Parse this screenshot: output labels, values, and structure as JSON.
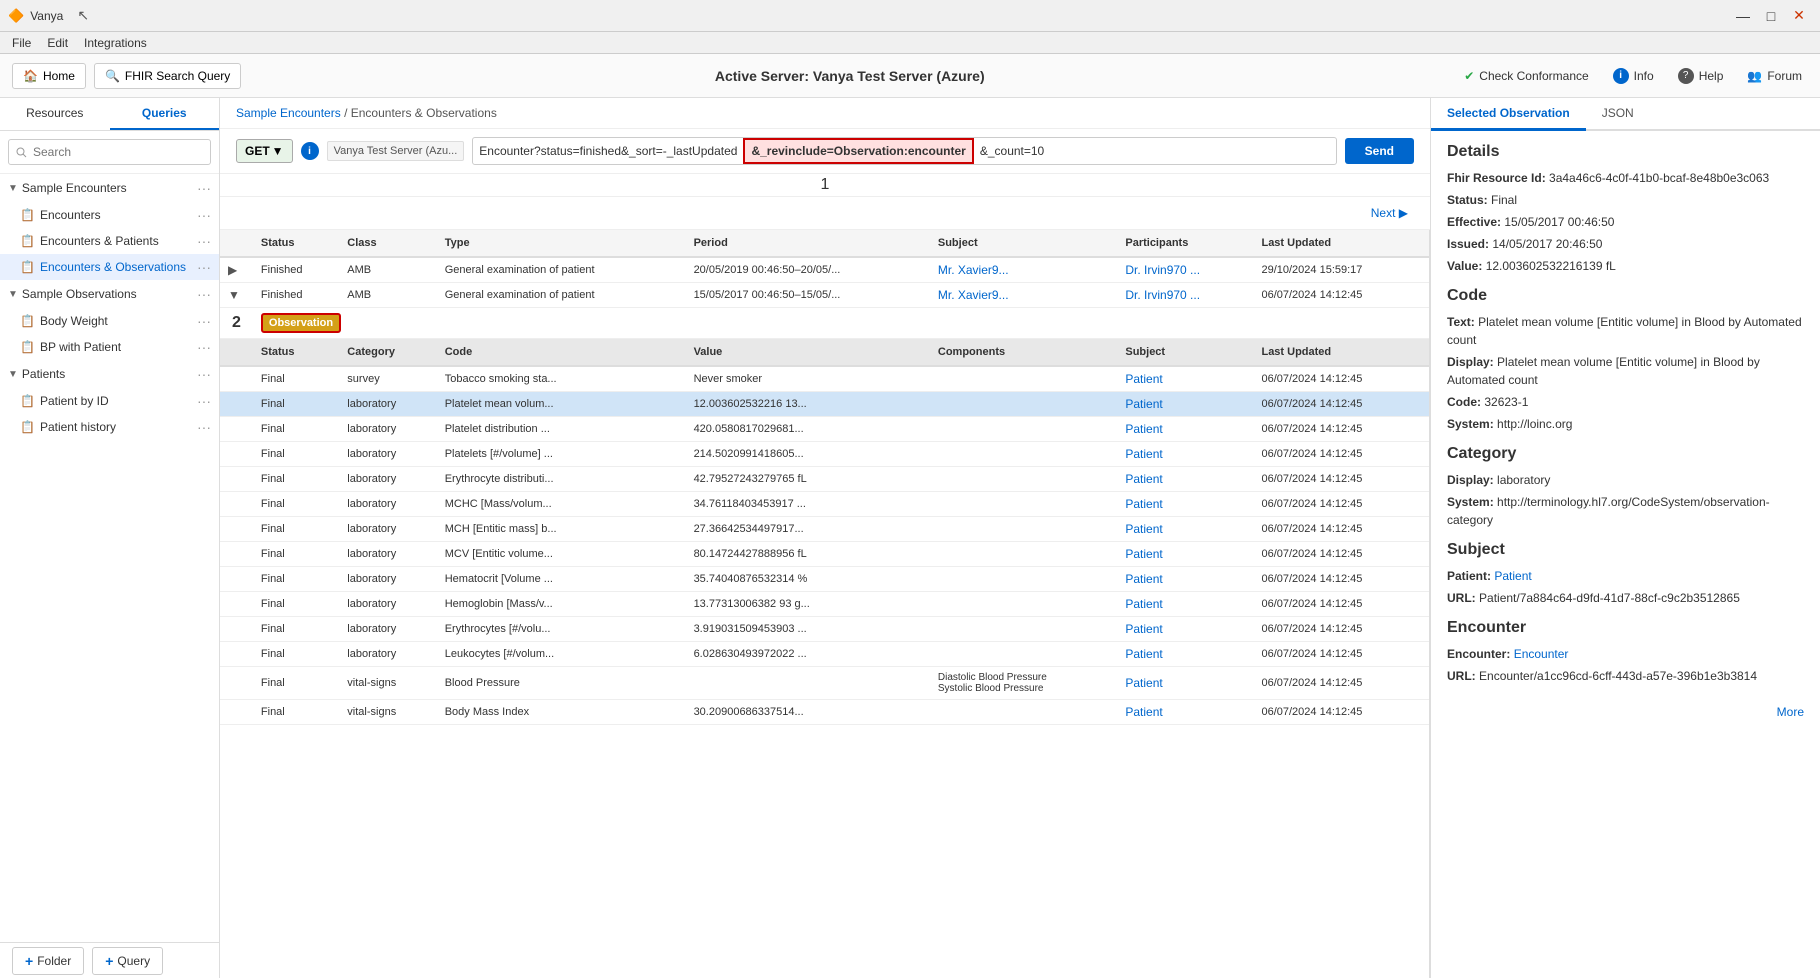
{
  "app": {
    "title": "Vanya",
    "logo_color": "#cc3300"
  },
  "titlebar": {
    "title": "Vanya",
    "controls": [
      "—",
      "□",
      "✕"
    ]
  },
  "menubar": {
    "items": [
      "File",
      "Edit",
      "Integrations"
    ]
  },
  "toolbar": {
    "home_label": "Home",
    "fhir_label": "FHIR Search Query",
    "active_server": "Active Server: Vanya Test Server (Azure)",
    "check_conformance": "Check Conformance",
    "info": "Info",
    "help": "Help",
    "forum": "Forum"
  },
  "sidebar": {
    "tabs": [
      "Resources",
      "Queries"
    ],
    "active_tab": "Queries",
    "search_placeholder": "Search",
    "groups": [
      {
        "id": "sample-encounters",
        "label": "Sample Encounters",
        "expanded": true,
        "items": [
          {
            "label": "Encounters",
            "active": false
          },
          {
            "label": "Encounters & Patients",
            "active": false
          },
          {
            "label": "Encounters & Observations",
            "active": true
          }
        ]
      },
      {
        "id": "sample-observations",
        "label": "Sample Observations",
        "expanded": true,
        "items": [
          {
            "label": "Body Weight",
            "active": false
          },
          {
            "label": "BP with Patient",
            "active": false
          }
        ]
      },
      {
        "id": "patients",
        "label": "Patients",
        "expanded": true,
        "items": [
          {
            "label": "Patient by ID",
            "active": false
          },
          {
            "label": "Patient history",
            "active": false
          }
        ]
      }
    ]
  },
  "breadcrumb": {
    "parent": "Sample Encounters",
    "current": "Encounters & Observations"
  },
  "query_bar": {
    "method": "GET",
    "server": "Vanya Test Server (Azu...",
    "query_part1": "Encounter?status=finished&_sort=-_lastUpdated",
    "query_highlight": "&_revinclude=Observation:encounter",
    "query_part2": "&_count=10",
    "send_label": "Send",
    "annotation": "1"
  },
  "nav": {
    "next_label": "Next"
  },
  "table": {
    "columns": [
      "",
      "Status",
      "Class",
      "Type",
      "Period",
      "Subject",
      "Participants",
      "Last Updated"
    ],
    "rows": [
      {
        "expand": "▶",
        "status": "Finished",
        "class": "AMB",
        "type": "General examination of patient",
        "period": "20/05/2019 00:46:50–20/05/...",
        "subject": "Mr. Xavier9...",
        "participants": "Dr. Irvin970 ...",
        "last_updated": "29/10/2024 15:59:17",
        "selected": false
      },
      {
        "expand": "▼",
        "status": "Finished",
        "class": "AMB",
        "type": "General examination of patient",
        "period": "15/05/2017 00:46:50–15/05/...",
        "subject": "Mr. Xavier9...",
        "participants": "Dr. Irvin970 ...",
        "last_updated": "06/07/2024 14:12:45",
        "selected": false
      }
    ],
    "observation_badge": "Observation",
    "annotation_2": "2",
    "obs_columns": [
      "",
      "Status",
      "Category",
      "Code",
      "Value",
      "Components",
      "Subject",
      "Last Updated"
    ],
    "obs_rows": [
      {
        "status": "Final",
        "category": "survey",
        "code": "Tobacco smoking sta...",
        "value": "Never smoker",
        "components": "",
        "subject": "Patient",
        "last_updated": "06/07/2024 14:12:45",
        "selected": false
      },
      {
        "status": "Final",
        "category": "laboratory",
        "code": "Platelet mean volum...",
        "value": "12.003602532216 13...",
        "components": "",
        "subject": "Patient",
        "last_updated": "06/07/2024 14:12:45",
        "selected": true
      },
      {
        "status": "Final",
        "category": "laboratory",
        "code": "Platelet distribution ...",
        "value": "420.0580817029681...",
        "components": "",
        "subject": "Patient",
        "last_updated": "06/07/2024 14:12:45",
        "selected": false
      },
      {
        "status": "Final",
        "category": "laboratory",
        "code": "Platelets [#/volume] ...",
        "value": "214.5020991418605...",
        "components": "",
        "subject": "Patient",
        "last_updated": "06/07/2024 14:12:45",
        "selected": false
      },
      {
        "status": "Final",
        "category": "laboratory",
        "code": "Erythrocyte distributi...",
        "value": "42.79527243279765 fL",
        "components": "",
        "subject": "Patient",
        "last_updated": "06/07/2024 14:12:45",
        "selected": false
      },
      {
        "status": "Final",
        "category": "laboratory",
        "code": "MCHC [Mass/volum...",
        "value": "34.76118403453917 ...",
        "components": "",
        "subject": "Patient",
        "last_updated": "06/07/2024 14:12:45",
        "selected": false
      },
      {
        "status": "Final",
        "category": "laboratory",
        "code": "MCH [Entitic mass] b...",
        "value": "27.36642534497917...",
        "components": "",
        "subject": "Patient",
        "last_updated": "06/07/2024 14:12:45",
        "selected": false
      },
      {
        "status": "Final",
        "category": "laboratory",
        "code": "MCV [Entitic volume...",
        "value": "80.14724427888956 fL",
        "components": "",
        "subject": "Patient",
        "last_updated": "06/07/2024 14:12:45",
        "selected": false
      },
      {
        "status": "Final",
        "category": "laboratory",
        "code": "Hematocrit [Volume ...",
        "value": "35.74040876532314 %",
        "components": "",
        "subject": "Patient",
        "last_updated": "06/07/2024 14:12:45",
        "selected": false
      },
      {
        "status": "Final",
        "category": "laboratory",
        "code": "Hemoglobin [Mass/v...",
        "value": "13.77313006382 93 g...",
        "components": "",
        "subject": "Patient",
        "last_updated": "06/07/2024 14:12:45",
        "selected": false
      },
      {
        "status": "Final",
        "category": "laboratory",
        "code": "Erythrocytes [#/volu...",
        "value": "3.919031509453903 ...",
        "components": "",
        "subject": "Patient",
        "last_updated": "06/07/2024 14:12:45",
        "selected": false
      },
      {
        "status": "Final",
        "category": "laboratory",
        "code": "Leukocytes [#/volum...",
        "value": "6.028630493972022 ...",
        "components": "",
        "subject": "Patient",
        "last_updated": "06/07/2024 14:12:45",
        "selected": false
      },
      {
        "status": "Final",
        "category": "vital-signs",
        "code": "Blood Pressure",
        "value": "",
        "components": "Diastolic Blood Pressure Systolic Blood Pressure",
        "subject": "Patient",
        "last_updated": "06/07/2024 14:12:45",
        "selected": false
      },
      {
        "status": "Final",
        "category": "vital-signs",
        "code": "Body Mass Index",
        "value": "30.20900686337514...",
        "components": "",
        "subject": "Patient",
        "last_updated": "06/07/2024 14:12:45",
        "selected": false
      }
    ]
  },
  "right_panel": {
    "tabs": [
      "Selected Observation",
      "JSON"
    ],
    "active_tab": "Selected Observation",
    "details": {
      "section_details": "Details",
      "fhir_resource_id_label": "Fhir Resource Id:",
      "fhir_resource_id": "3a4a46c6-4c0f-41b0-bcaf-8e48b0e3c063",
      "status_label": "Status:",
      "status": "Final",
      "effective_label": "Effective:",
      "effective": "15/05/2017 00:46:50",
      "issued_label": "Issued:",
      "issued": "14/05/2017 20:46:50",
      "value_label": "Value:",
      "value": "12.003602532216139 fL",
      "section_code": "Code",
      "text_label": "Text:",
      "text": "Platelet mean volume [Entitic volume] in Blood by Automated count",
      "display_label": "Display:",
      "display": "Platelet mean volume [Entitic volume] in Blood by Automated count",
      "code_label": "Code:",
      "code": "32623-1",
      "system_label": "System:",
      "system": "http://loinc.org",
      "section_category": "Category",
      "cat_display_label": "Display:",
      "cat_display": "laboratory",
      "cat_system_label": "System:",
      "cat_system": "http://terminology.hl7.org/CodeSystem/observation-category",
      "section_subject": "Subject",
      "patient_label": "Patient:",
      "patient_link": "Patient",
      "patient_url_label": "URL:",
      "patient_url": "Patient/7a884c64-d9fd-41d7-88cf-c9c2b3512865",
      "section_encounter": "Encounter",
      "encounter_label": "Encounter:",
      "encounter_link": "Encounter",
      "encounter_url_label": "URL:",
      "encounter_url": "Encounter/a1cc96cd-6cff-443d-a57e-396b1e3b3814",
      "more_label": "More"
    }
  },
  "bottom_bar": {
    "folder_label": "Folder",
    "query_label": "Query"
  }
}
